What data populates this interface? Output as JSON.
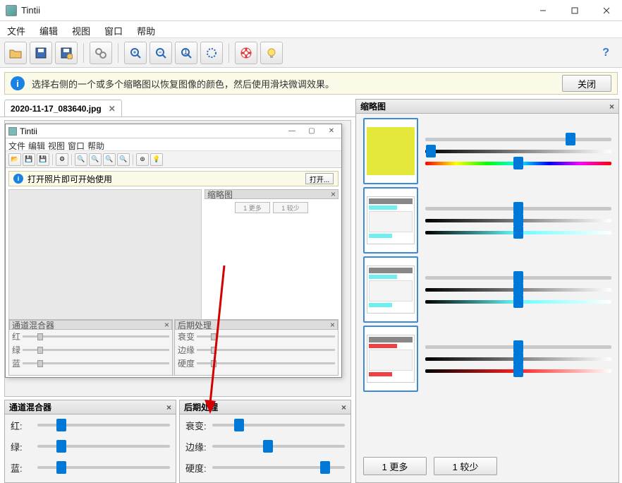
{
  "window": {
    "title": "Tintii"
  },
  "menu": {
    "file": "文件",
    "edit": "编辑",
    "view": "视图",
    "window": "窗口",
    "help": "帮助"
  },
  "info": {
    "message": "选择右侧的一个或多个缩略图以恢复图像的颜色，然后使用滑块微调效果。",
    "close_label": "关闭"
  },
  "tab": {
    "name": "2020-11-17_083640.jpg"
  },
  "nested": {
    "title": "Tintii",
    "menu": {
      "file": "文件",
      "edit": "编辑",
      "view": "视图",
      "window": "窗口",
      "help": "帮助"
    },
    "info_msg": "打开照片即可开始使用",
    "open_label": "打开...",
    "thumb_hdr": "缩略图",
    "more": "1 更多",
    "less": "1 较少",
    "mixer_hdr": "通道混合器",
    "post_hdr": "后期处理",
    "mixer": {
      "r": "红",
      "g": "绿",
      "b": "蓝"
    },
    "post": {
      "decay": "衰变",
      "edge": "边缘",
      "hard": "硬度"
    }
  },
  "mixer": {
    "title": "通道混合器",
    "r": "红:",
    "g": "绿:",
    "b": "蓝:",
    "r_val": 18,
    "g_val": 18,
    "b_val": 18
  },
  "post": {
    "title": "后期处理",
    "decay": "衰变:",
    "edge": "边缘:",
    "hard": "硬度:",
    "decay_val": 20,
    "edge_val": 42,
    "hard_val": 85
  },
  "thumbs": {
    "title": "缩略图",
    "more": "1 更多",
    "less": "1 较少",
    "rows": [
      {
        "color": "#e4e83a",
        "s1": 78,
        "s2": 3,
        "s3": 50
      },
      {
        "color": "#6fefef",
        "s1": 50,
        "s2": 50,
        "s3": 50
      },
      {
        "color": "#6fefef",
        "s1": 50,
        "s2": 50,
        "s3": 50
      },
      {
        "color": "#f04040",
        "s1": 50,
        "s2": 50,
        "s3": 50
      }
    ]
  }
}
